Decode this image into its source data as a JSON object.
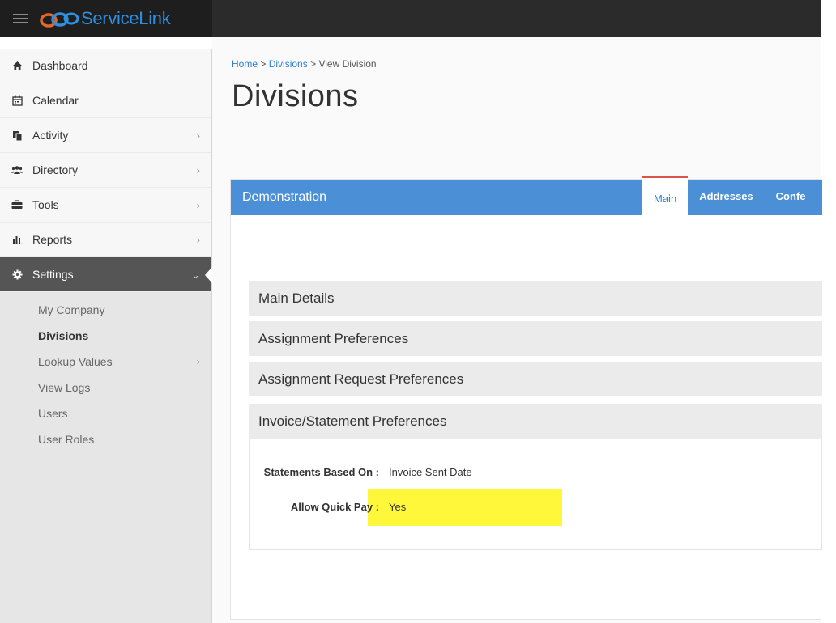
{
  "app": {
    "brand": "ServiceLink"
  },
  "sidebar": {
    "items": [
      {
        "label": "Dashboard",
        "icon": "home-icon",
        "has_children": false
      },
      {
        "label": "Calendar",
        "icon": "calendar-icon",
        "has_children": false
      },
      {
        "label": "Activity",
        "icon": "files-icon",
        "has_children": true
      },
      {
        "label": "Directory",
        "icon": "users-icon",
        "has_children": true
      },
      {
        "label": "Tools",
        "icon": "briefcase-icon",
        "has_children": true
      },
      {
        "label": "Reports",
        "icon": "bar-chart-icon",
        "has_children": true
      },
      {
        "label": "Settings",
        "icon": "gear-icon",
        "has_children": true,
        "active": true
      }
    ],
    "settings_sub_items": [
      {
        "label": "My Company"
      },
      {
        "label": "Divisions",
        "current": true
      },
      {
        "label": "Lookup Values",
        "has_children": true
      },
      {
        "label": "View Logs"
      },
      {
        "label": "Users"
      },
      {
        "label": "User Roles"
      }
    ]
  },
  "breadcrumb": {
    "home": "Home",
    "sep": ">",
    "divisions": "Divisions",
    "current": "View Division"
  },
  "page": {
    "title": "Divisions"
  },
  "panel": {
    "title": "Demonstration",
    "tabs": [
      {
        "label": "Main",
        "active": true
      },
      {
        "label": "Addresses"
      },
      {
        "label": "Confe"
      }
    ],
    "sections": [
      {
        "label": "Main Details"
      },
      {
        "label": "Assignment Preferences"
      },
      {
        "label": "Assignment Request Preferences"
      },
      {
        "label": "Invoice/Statement Preferences"
      }
    ],
    "invoice_fields": [
      {
        "label": "Statements Based On :",
        "value": "Invoice Sent Date"
      },
      {
        "label": "Allow Quick Pay :",
        "value": "Yes"
      }
    ]
  },
  "colors": {
    "topbar": "#2b2b2b",
    "brand": "#2f8fe0",
    "panel_header": "#4b8fd6",
    "active_tab_top": "#d9534f",
    "highlight": "#fff73a",
    "sidebar_active": "#555555"
  }
}
